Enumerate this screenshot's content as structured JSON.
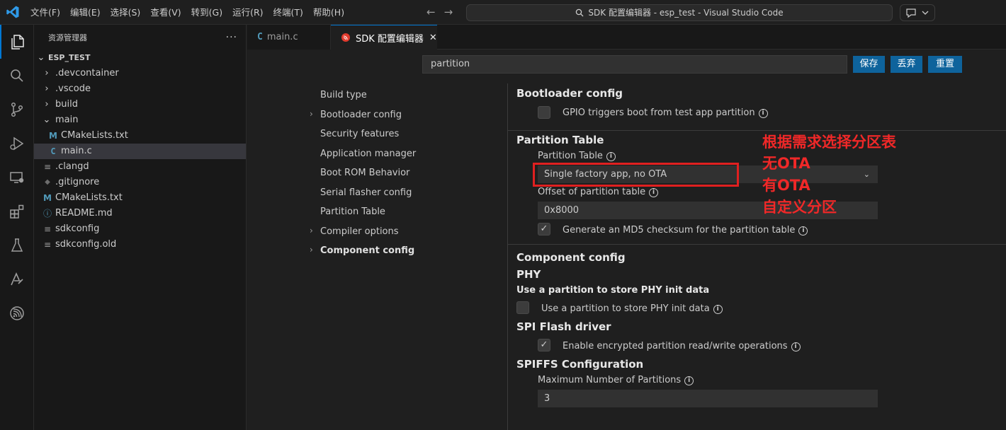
{
  "menu": [
    "文件(F)",
    "编辑(E)",
    "选择(S)",
    "查看(V)",
    "转到(G)",
    "运行(R)",
    "终端(T)",
    "帮助(H)"
  ],
  "command_center": "SDK 配置编辑器 - esp_test - Visual Studio Code",
  "sidebar": {
    "title": "资源管理器",
    "root": "ESP_TEST",
    "items": [
      {
        "label": ".devcontainer",
        "icon": "chevron-right"
      },
      {
        "label": ".vscode",
        "icon": "chevron-right"
      },
      {
        "label": "build",
        "icon": "chevron-right"
      },
      {
        "label": "main",
        "icon": "chevron-down"
      },
      {
        "label": "CMakeLists.txt",
        "icon": "M"
      },
      {
        "label": "main.c",
        "icon": "C"
      },
      {
        "label": ".clangd",
        "icon": "≡"
      },
      {
        "label": ".gitignore",
        "icon": "◆"
      },
      {
        "label": "CMakeLists.txt",
        "icon": "M"
      },
      {
        "label": "README.md",
        "icon": "ⓘ"
      },
      {
        "label": "sdkconfig",
        "icon": "≡"
      },
      {
        "label": "sdkconfig.old",
        "icon": "≡"
      }
    ]
  },
  "tabs": [
    {
      "label": "main.c",
      "icon": "C"
    },
    {
      "label": "SDK 配置编辑器",
      "icon": "esp-icon",
      "close": "✕"
    }
  ],
  "search": {
    "value": "partition"
  },
  "buttons": {
    "save": "保存",
    "discard": "丢弃",
    "reset": "重置"
  },
  "nav": [
    {
      "label": "Build type"
    },
    {
      "label": "Bootloader config",
      "chevron": "›"
    },
    {
      "label": "Security features"
    },
    {
      "label": "Application manager"
    },
    {
      "label": "Boot ROM Behavior"
    },
    {
      "label": "Serial flasher config"
    },
    {
      "label": "Partition Table"
    },
    {
      "label": "Compiler options",
      "chevron": "›"
    },
    {
      "label": "Component config",
      "chevron": "›"
    }
  ],
  "content": {
    "bootloader": {
      "title": "Bootloader config",
      "gpio_label": "GPIO triggers boot from test app partition",
      "gpio_checked": false
    },
    "partition_table": {
      "title": "Partition Table",
      "field_label": "Partition Table",
      "selected": "Single factory app, no OTA",
      "offset_label": "Offset of partition table",
      "offset_value": "0x8000",
      "md5_label": "Generate an MD5 checksum for the partition table",
      "md5_checked": true
    },
    "component": {
      "title": "Component config",
      "phy_title": "PHY",
      "phy_subtitle": "Use a partition to store PHY init data",
      "phy_label": "Use a partition to store PHY init data",
      "phy_checked": false,
      "spi_title": "SPI Flash driver",
      "spi_label": "Enable encrypted partition read/write operations",
      "spi_checked": true,
      "spiffs_title": "SPIFFS Configuration",
      "spiffs_label": "Maximum Number of Partitions",
      "spiffs_value": "3"
    }
  },
  "annotation": [
    "根据需求选择分区表",
    "无OTA",
    "有OTA",
    "自定义分区"
  ],
  "colors": {
    "accent": "#0078d4",
    "button": "#0e639c",
    "annotation": "#f02828"
  }
}
